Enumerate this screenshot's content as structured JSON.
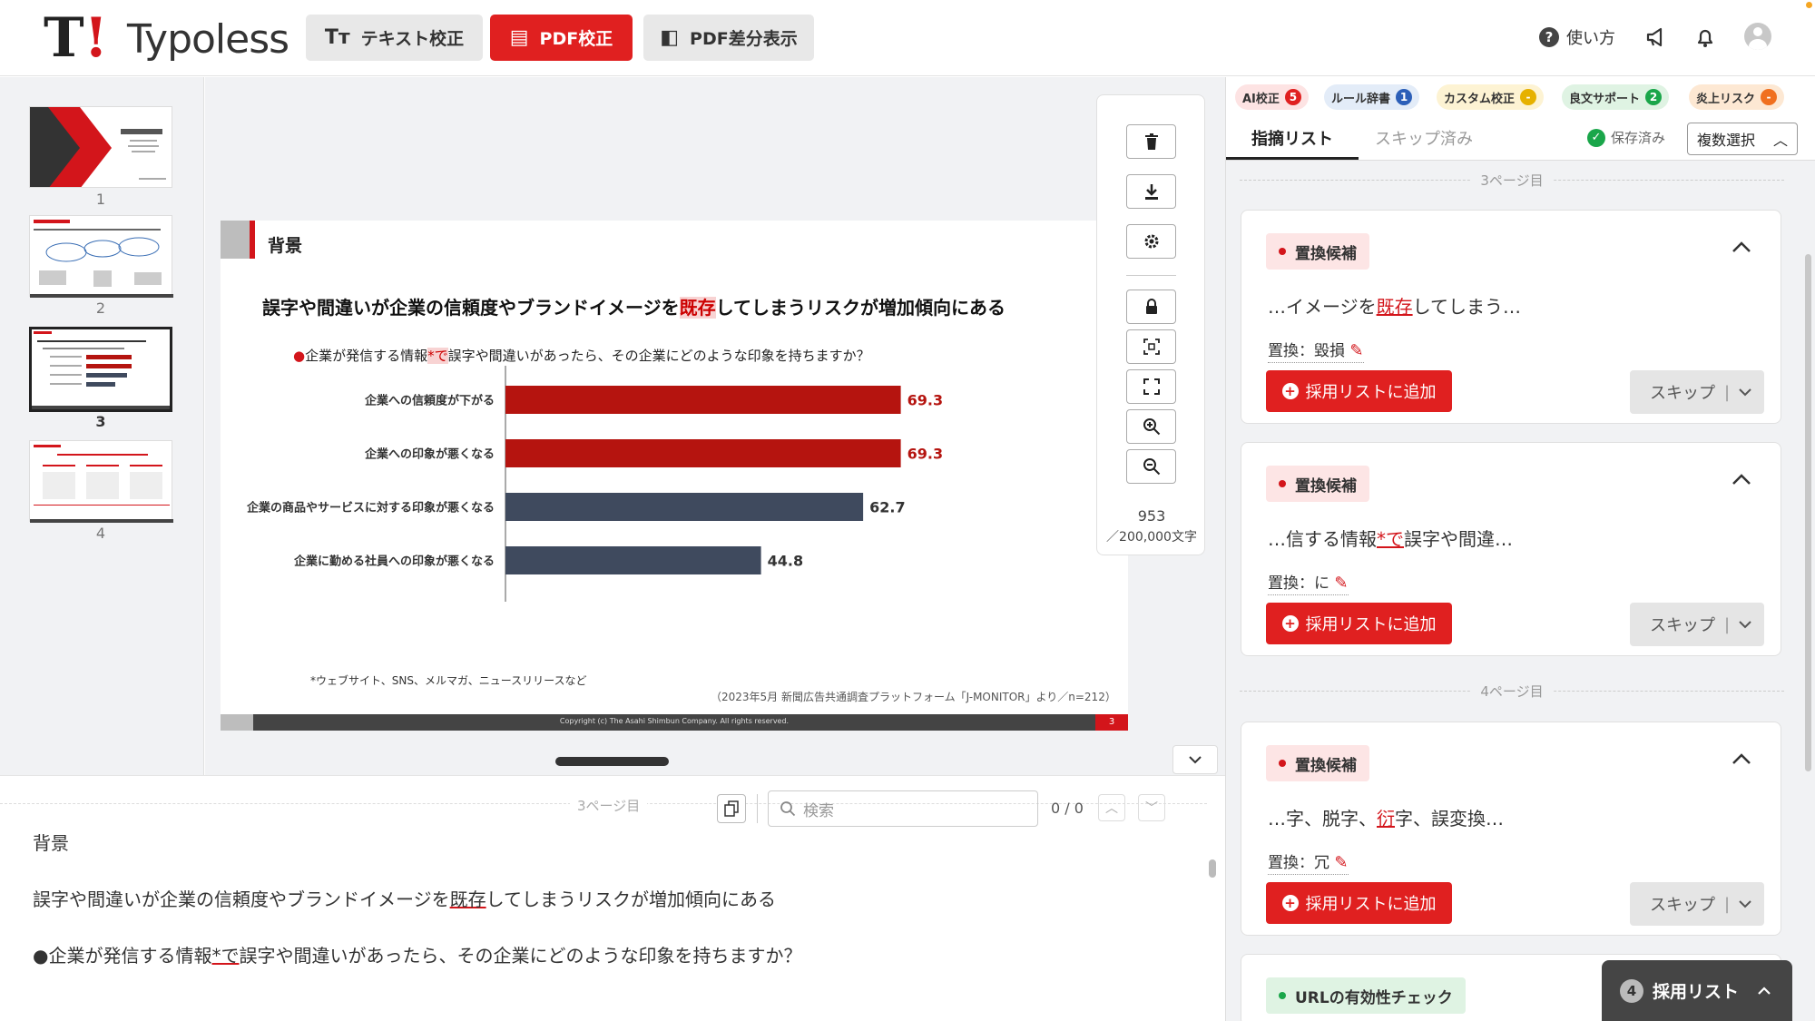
{
  "header": {
    "logo_mark": "T",
    "logo_mark_bang": "!",
    "logo_text": "Typoless",
    "tabs": [
      {
        "label": "テキスト校正",
        "icon": "Tт"
      },
      {
        "label": "PDF校正",
        "icon": "▤"
      },
      {
        "label": "PDF差分表示",
        "icon": "◧"
      }
    ],
    "help_label": "使い方",
    "help_icon": "?"
  },
  "thumbnails": [
    {
      "page": "1"
    },
    {
      "page": "2"
    },
    {
      "page": "3"
    },
    {
      "page": "4"
    }
  ],
  "thumb_logo": "T! Typoless",
  "slide": {
    "section": "背景",
    "title_pre": "誤字や間違いが企業の信頼度やブランドイメージを",
    "title_hl": "既存",
    "title_post": "してしまうリスクが増加傾向にある",
    "question_dot": "●",
    "question_pre": "企業が発信する情報",
    "question_hl": "*で",
    "question_post": "誤字や間違いがあったら、その企業にどのような印象を持ちますか？",
    "footnote": "*ウェブサイト、SNS、メルマガ、ニュースリリースなど",
    "source": "（2023年5月 新聞広告共通調査プラットフォーム「J-MONITOR」より／n=212）",
    "copyright": "Copyright (c) The Asahi Shimbun Company. All rights reserved.",
    "page_no": "3"
  },
  "chart_data": {
    "type": "bar",
    "orientation": "horizontal",
    "categories": [
      "企業への信頼度が下がる",
      "企業への印象が悪くなる",
      "企業の商品やサービスに対する印象が悪くなる",
      "企業に勤める社員への印象が悪くなる"
    ],
    "values": [
      69.3,
      69.3,
      62.7,
      44.8
    ],
    "colors": [
      "#b5140f",
      "#b5140f",
      "#3f4a5e",
      "#3f4a5e"
    ],
    "value_colors": [
      "#b5140f",
      "#b5140f",
      "#333333",
      "#333333"
    ],
    "xlim": [
      0,
      100
    ]
  },
  "toolbar": {
    "char_count": "953",
    "char_limit": "／200,000文字"
  },
  "text_panel": {
    "page_label": "3ページ目",
    "search_placeholder": "検索",
    "search_count": "0 / 0",
    "line1": "背景",
    "line2_pre": "誤字や間違いが企業の信頼度やブランドイメージを",
    "line2_u": "既存",
    "line2_post": "してしまうリスクが増加傾向にある",
    "line3_pre": "●企業が発信する情報",
    "line3_u": "*で",
    "line3_post": "誤字や間違いがあったら、その企業にどのような印象を持ちますか？"
  },
  "right_panel": {
    "tags": [
      {
        "label": "AI校正",
        "count": "5",
        "bg": "#fde3e3",
        "ncolor": "#e02020"
      },
      {
        "label": "ルール辞書",
        "count": "1",
        "bg": "#e3ecf8",
        "ncolor": "#2c5fb8"
      },
      {
        "label": "カスタム校正",
        "count": "-",
        "bg": "#fdf3d3",
        "ncolor": "#e6b100"
      },
      {
        "label": "良文サポート",
        "count": "2",
        "bg": "#dff3e3",
        "ncolor": "#1aa64a"
      },
      {
        "label": "炎上リスク",
        "count": "-",
        "bg": "#fde8d3",
        "ncolor": "#f07020"
      }
    ],
    "tab_active": "指摘リスト",
    "tab_skip": "スキップ済み",
    "saved_label": "保存済み",
    "multi_select": "複数選択",
    "page3_label": "3ページ目",
    "page4_label": "4ページ目",
    "cards": [
      {
        "badge": "置換候補",
        "pre": "…イメージを",
        "u": "既存",
        "post": "してしまう…",
        "replace": "置換：毀損",
        "add": "採用リストに追加",
        "skip": "スキップ"
      },
      {
        "badge": "置換候補",
        "pre": "…信する情報",
        "u": "*で",
        "post": "誤字や間違…",
        "replace": "置換：に",
        "add": "採用リストに追加",
        "skip": "スキップ"
      },
      {
        "badge": "置換候補",
        "pre": "…字、脱字、",
        "u": "衍",
        "post": "字、誤変換…",
        "replace": "置換：冗",
        "add": "採用リストに追加",
        "skip": "スキップ"
      }
    ],
    "url_check": "URLの有効性チェック",
    "adopt_count": "4",
    "adopt_label": "採用リスト"
  }
}
